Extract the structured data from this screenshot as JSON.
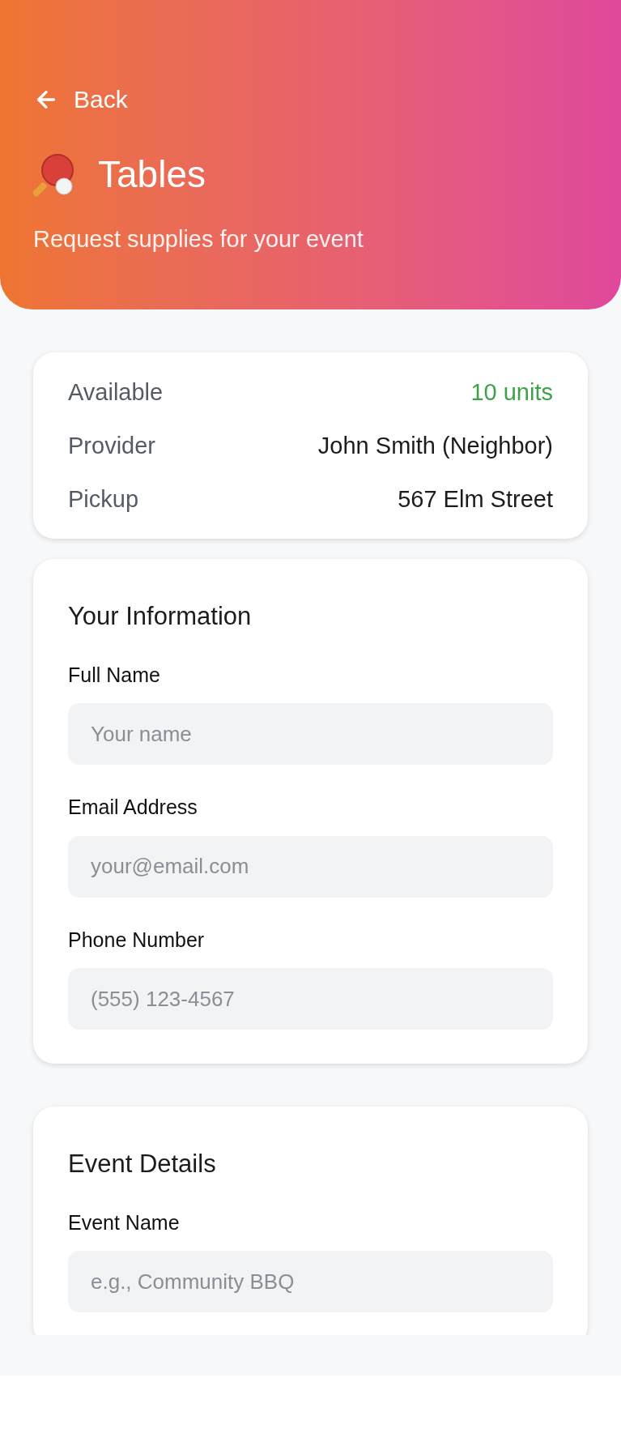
{
  "header": {
    "back": "Back",
    "title": "Tables",
    "subtitle": "Request supplies for your event"
  },
  "summary": [
    {
      "label": "Available",
      "value": "10 units",
      "kind": "highlight"
    },
    {
      "label": "Provider",
      "value": "John Smith (Neighbor)",
      "kind": "plain"
    },
    {
      "label": "Pickup",
      "value": "567 Elm Street",
      "kind": "plain"
    }
  ],
  "sections": [
    {
      "title": "Your Information",
      "fields": [
        {
          "label": "Full Name",
          "placeholder": "Your name"
        },
        {
          "label": "Email Address",
          "placeholder": "your@email.com"
        },
        {
          "label": "Phone Number",
          "placeholder": "(555) 123-4567"
        }
      ]
    },
    {
      "title": "Event Details",
      "fields": [
        {
          "label": "Event Name",
          "placeholder": "e.g., Community BBQ"
        }
      ]
    }
  ]
}
